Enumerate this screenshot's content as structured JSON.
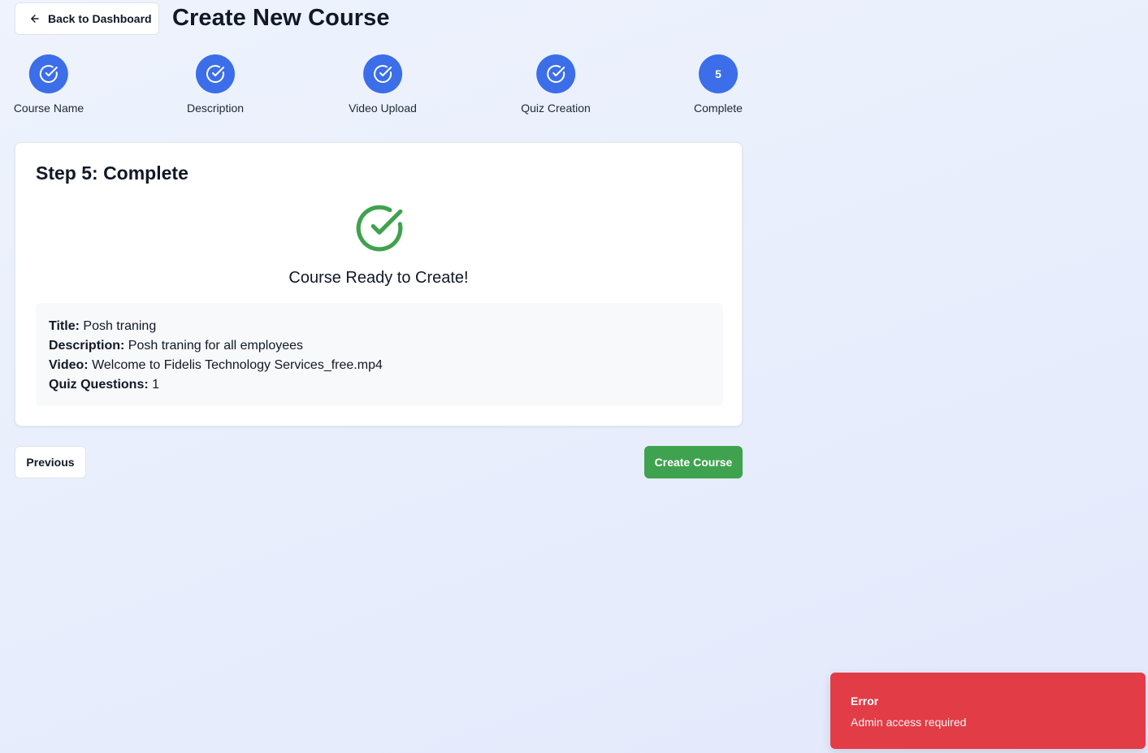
{
  "header": {
    "back_label": "Back to Dashboard",
    "back_icon": "arrow-left-icon",
    "title": "Create New Course"
  },
  "stepper": {
    "steps": [
      {
        "label": "Course Name",
        "state": "done",
        "icon": "check-circle-icon"
      },
      {
        "label": "Description",
        "state": "done",
        "icon": "check-circle-icon"
      },
      {
        "label": "Video Upload",
        "state": "done",
        "icon": "check-circle-icon"
      },
      {
        "label": "Quiz Creation",
        "state": "done",
        "icon": "check-circle-icon"
      },
      {
        "label": "Complete",
        "state": "current",
        "number": "5"
      }
    ]
  },
  "card": {
    "title": "Step 5: Complete",
    "status_icon": "check-circle-icon",
    "ready_text": "Course Ready to Create!",
    "summary": {
      "title_label": "Title:",
      "title_value": "Posh traning",
      "description_label": "Description:",
      "description_value": "Posh traning for all employees",
      "video_label": "Video:",
      "video_value": "Welcome to Fidelis Technology Services_free.mp4",
      "quiz_label": "Quiz Questions:",
      "quiz_value": "1"
    }
  },
  "actions": {
    "previous_label": "Previous",
    "create_label": "Create Course"
  },
  "toast": {
    "title": "Error",
    "message": "Admin access required"
  },
  "colors": {
    "primary": "#3b6ee8",
    "success": "#3fa24e",
    "error": "#e23c47"
  }
}
